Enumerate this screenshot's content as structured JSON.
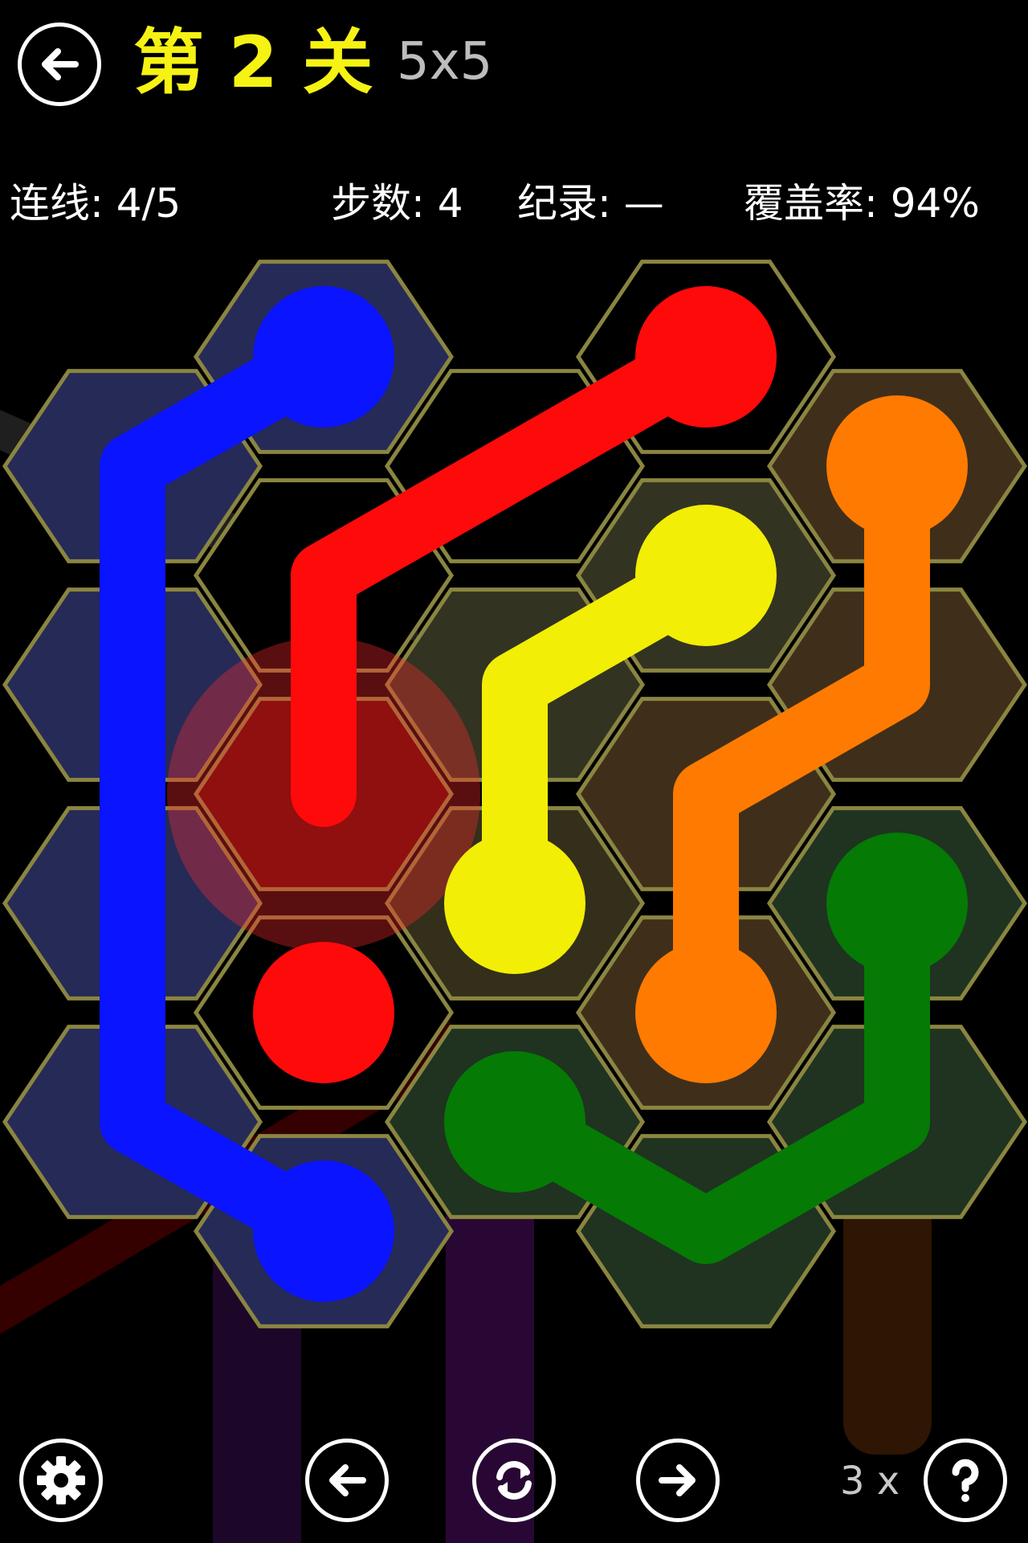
{
  "header": {
    "back_label": "←",
    "level_title": "第 2 关",
    "grid_size": "5x5"
  },
  "stats": {
    "links": "连线: 4/5",
    "moves": "步数: 4",
    "record": "纪录: —",
    "coverage": "覆盖率: 94%"
  },
  "colors": {
    "background": "#000000",
    "title": "#f5f214",
    "hex_border": "#8a8540",
    "blue": "#0a14ff",
    "red": "#ff0a0a",
    "orange": "#ff7a00",
    "yellow": "#f2ee05",
    "green": "#057a05"
  },
  "board": {
    "shape": "hexagonal-grid",
    "flows": [
      {
        "color": "blue",
        "state": "connected"
      },
      {
        "color": "red",
        "state": "incomplete"
      },
      {
        "color": "orange",
        "state": "connected"
      },
      {
        "color": "yellow",
        "state": "connected"
      },
      {
        "color": "green",
        "state": "connected"
      }
    ]
  },
  "toolbar": {
    "settings_icon": "gear-icon",
    "prev_icon": "arrow-left-icon",
    "restart_icon": "refresh-icon",
    "next_icon": "arrow-right-icon",
    "hint_icon": "question-icon",
    "hint_count": "3 x"
  }
}
